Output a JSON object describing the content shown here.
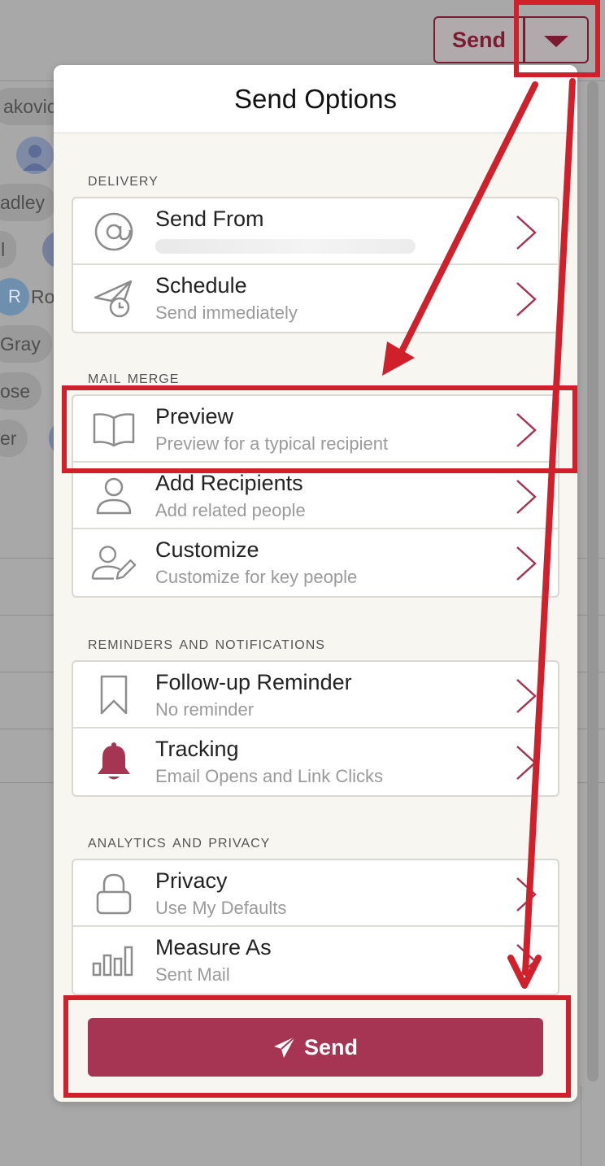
{
  "background": {
    "send_label": "Send",
    "chips": [
      "akovich",
      "adley",
      "ll",
      "Ro",
      "Gray",
      "ose",
      "er"
    ],
    "avatar_initial": "R"
  },
  "modal": {
    "title": "Send Options",
    "send_button_label": "Send",
    "sections": [
      {
        "title": "Delivery",
        "rows": [
          {
            "icon": "at-icon",
            "title": "Send From",
            "subtitle": ""
          },
          {
            "icon": "schedule-icon",
            "title": "Schedule",
            "subtitle": "Send immediately"
          }
        ]
      },
      {
        "title": "Mail Merge",
        "rows": [
          {
            "icon": "book-icon",
            "title": "Preview",
            "subtitle": "Preview for a typical recipient"
          },
          {
            "icon": "person-icon",
            "title": "Add Recipients",
            "subtitle": "Add related people"
          },
          {
            "icon": "person-edit-icon",
            "title": "Customize",
            "subtitle": "Customize for key people"
          }
        ]
      },
      {
        "title": "Reminders and Notifications",
        "rows": [
          {
            "icon": "bookmark-icon",
            "title": "Follow-up Reminder",
            "subtitle": "No reminder"
          },
          {
            "icon": "bell-icon",
            "title": "Tracking",
            "subtitle": "Email Opens and Link Clicks"
          }
        ]
      },
      {
        "title": "Analytics and Privacy",
        "rows": [
          {
            "icon": "lock-icon",
            "title": "Privacy",
            "subtitle": "Use My Defaults"
          },
          {
            "icon": "bar-chart-icon",
            "title": "Measure As",
            "subtitle": "Sent Mail"
          }
        ]
      }
    ]
  },
  "colors": {
    "accent": "#a53553",
    "annotation": "#d0202b",
    "dim_overlay": "#a8a8a8"
  }
}
